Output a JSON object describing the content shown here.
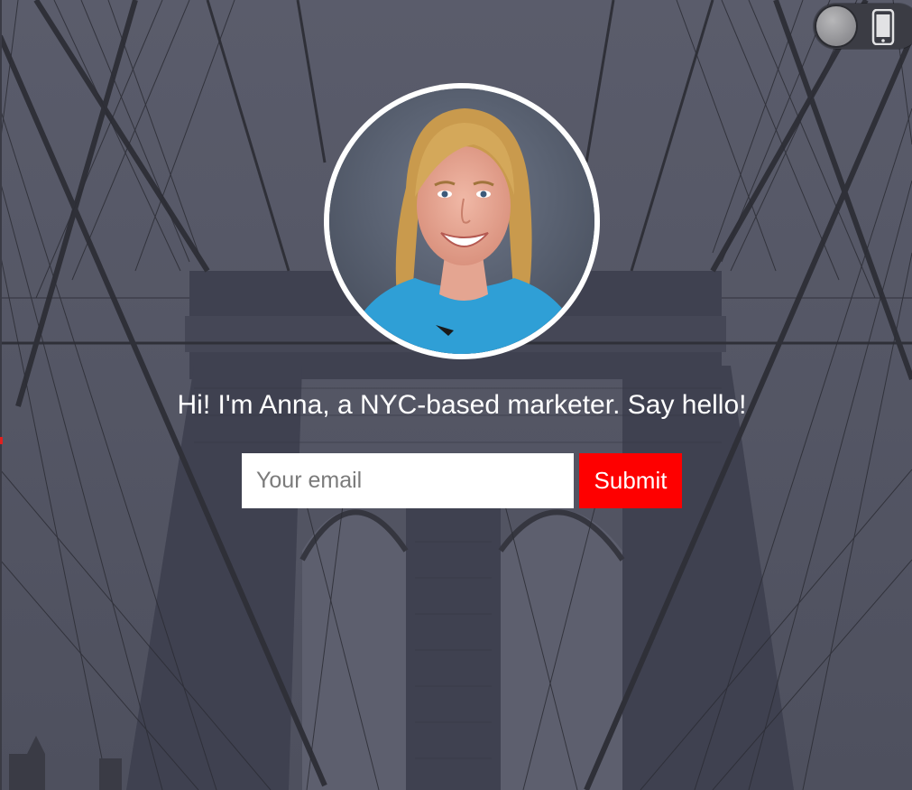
{
  "hero": {
    "tagline": "Hi! I'm Anna, a NYC-based marketer. Say hello!",
    "avatar_alt": "Anna profile photo"
  },
  "form": {
    "email_placeholder": "Your email",
    "email_value": "",
    "submit_label": "Submit"
  },
  "view_toggle": {
    "icon": "mobile-phone-icon",
    "state": "mobile"
  },
  "colors": {
    "overlay": "#585a69",
    "accent": "#fe0000",
    "text": "#ffffff"
  }
}
